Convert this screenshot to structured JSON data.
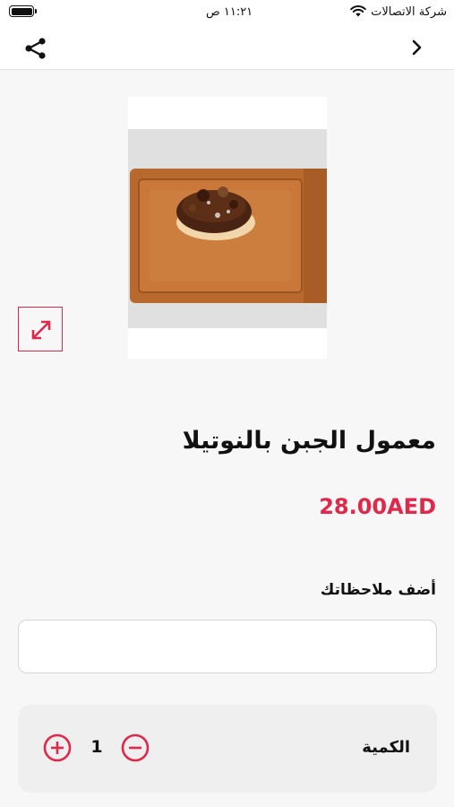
{
  "status_bar": {
    "carrier": "شركة الاتصالات",
    "time": "١١:٢١ ص",
    "wifi_icon": "wifi-icon",
    "battery_icon": "battery-icon"
  },
  "nav": {
    "back_icon": "chevron-right-icon",
    "share_icon": "share-icon"
  },
  "product": {
    "title": "معمول الجبن بالنوتيلا",
    "price": "28.00AED",
    "expand_icon": "expand-icon"
  },
  "notes": {
    "label": "أضف ملاحظاتك",
    "value": "",
    "placeholder": ""
  },
  "quantity": {
    "label": "الكمية",
    "value": "1",
    "plus_icon": "plus-circle-icon",
    "minus_icon": "minus-circle-icon"
  },
  "colors": {
    "accent": "#e0284a",
    "background": "#f7f7f7",
    "card": "#efefef"
  }
}
